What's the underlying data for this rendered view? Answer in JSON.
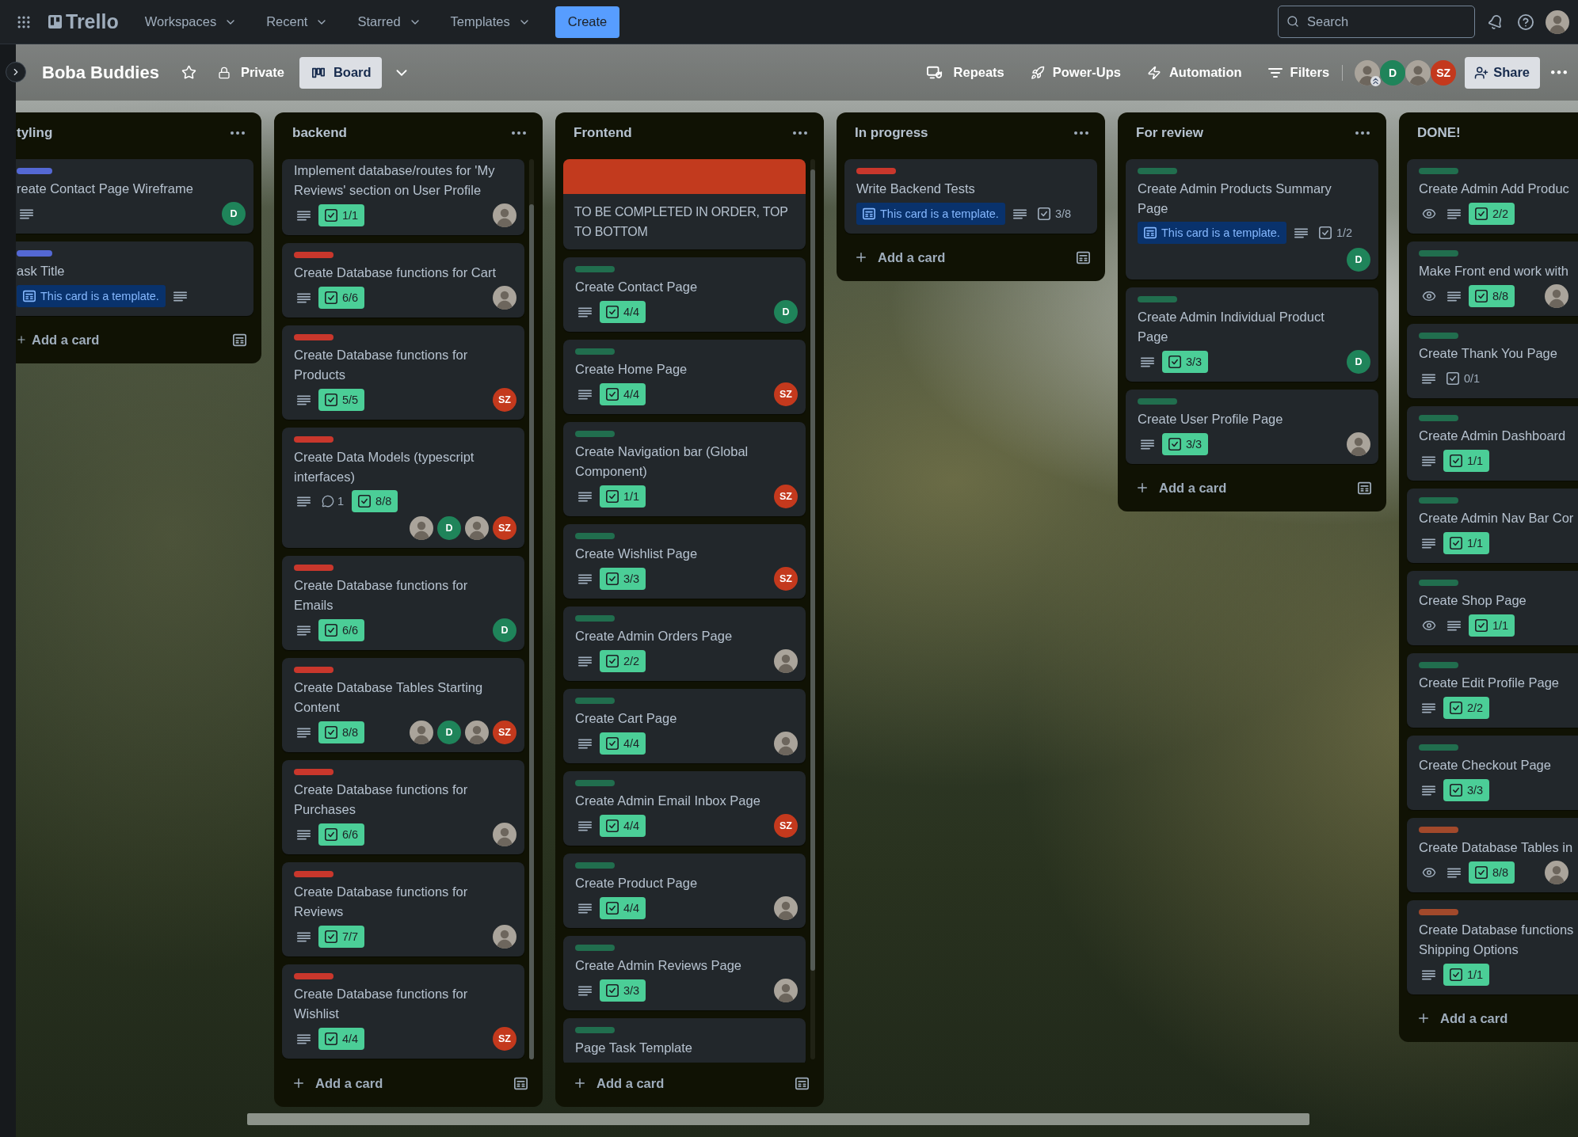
{
  "top_nav": {
    "logo": "Trello",
    "menus": [
      {
        "label": "Workspaces"
      },
      {
        "label": "Recent"
      },
      {
        "label": "Starred"
      },
      {
        "label": "Templates"
      }
    ],
    "create_button": "Create",
    "search": {
      "placeholder": "Search"
    }
  },
  "board_header": {
    "title": "Boba Buddies",
    "starred": false,
    "visibility": "Private",
    "view_button": "Board",
    "actions": [
      {
        "kind": "repeats",
        "label": "Repeats"
      },
      {
        "kind": "power_ups",
        "label": "Power-Ups"
      },
      {
        "kind": "automation",
        "label": "Automation"
      },
      {
        "kind": "filters",
        "label": "Filters"
      }
    ],
    "members": [
      {
        "kind": "photo",
        "admin": true
      },
      {
        "kind": "initials",
        "text": "D",
        "color": "#1f845a",
        "admin": false
      },
      {
        "kind": "photo",
        "admin": false
      },
      {
        "kind": "initials",
        "text": "SZ",
        "color": "#c4391d",
        "admin": false
      }
    ],
    "share_button": "Share"
  },
  "lists": [
    {
      "title": "tyling",
      "add_card": "Add a card",
      "cards": [
        {
          "label": {
            "color": "#5468d4"
          },
          "title": "reate Contact Page Wireframe",
          "watching": false,
          "description": true,
          "members": [
            {
              "kind": "initials",
              "text": "D",
              "color": "#1f845a"
            }
          ]
        },
        {
          "label": {
            "color": "#5468d4"
          },
          "title": "ask Title",
          "template_badge": "This card is a template.",
          "watching": false,
          "description": true
        }
      ]
    },
    {
      "title": "backend",
      "add_card": "Add a card",
      "cards": [
        {
          "title": "Implement database/routes for 'My Reviews' section on User Profile",
          "watching": false,
          "description": true,
          "checklist": {
            "text": "1/1",
            "complete": true
          },
          "members": [
            {
              "kind": "photo"
            }
          ]
        },
        {
          "label": {
            "color": "#c9372c"
          },
          "title": "Create Database functions for Cart",
          "watching": false,
          "description": true,
          "checklist": {
            "text": "6/6",
            "complete": true
          },
          "members": [
            {
              "kind": "photo"
            }
          ]
        },
        {
          "label": {
            "color": "#c9372c"
          },
          "title": "Create Database functions for Products",
          "watching": false,
          "description": true,
          "checklist": {
            "text": "5/5",
            "complete": true
          },
          "members": [
            {
              "kind": "initials",
              "text": "SZ",
              "color": "#c4391d"
            }
          ]
        },
        {
          "label": {
            "color": "#c9372c"
          },
          "title": "Create Data Models (typescript interfaces)",
          "watching": false,
          "description": true,
          "comments": "1",
          "checklist": {
            "text": "8/8",
            "complete": true
          },
          "members": [
            {
              "kind": "photo"
            },
            {
              "kind": "initials",
              "text": "D",
              "color": "#1f845a"
            },
            {
              "kind": "photo"
            },
            {
              "kind": "initials",
              "text": "SZ",
              "color": "#c4391d"
            }
          ]
        },
        {
          "label": {
            "color": "#c9372c"
          },
          "title": "Create Database functions for Emails",
          "watching": false,
          "description": true,
          "checklist": {
            "text": "6/6",
            "complete": true
          },
          "members": [
            {
              "kind": "initials",
              "text": "D",
              "color": "#1f845a"
            }
          ]
        },
        {
          "label": {
            "color": "#c9372c"
          },
          "title": "Create Database Tables Starting Content",
          "watching": false,
          "description": true,
          "checklist": {
            "text": "8/8",
            "complete": true
          },
          "members": [
            {
              "kind": "photo"
            },
            {
              "kind": "initials",
              "text": "D",
              "color": "#1f845a"
            },
            {
              "kind": "photo"
            },
            {
              "kind": "initials",
              "text": "SZ",
              "color": "#c4391d"
            }
          ]
        },
        {
          "label": {
            "color": "#c9372c"
          },
          "title": "Create Database functions for Purchases",
          "watching": false,
          "description": true,
          "checklist": {
            "text": "6/6",
            "complete": true
          },
          "members": [
            {
              "kind": "photo"
            }
          ]
        },
        {
          "label": {
            "color": "#c9372c"
          },
          "title": "Create Database functions for Reviews",
          "watching": false,
          "description": true,
          "checklist": {
            "text": "7/7",
            "complete": true
          },
          "members": [
            {
              "kind": "photo"
            }
          ]
        },
        {
          "label": {
            "color": "#c9372c"
          },
          "title": "Create Database functions for Wishlist",
          "watching": false,
          "description": true,
          "checklist": {
            "text": "4/4",
            "complete": true
          },
          "members": [
            {
              "kind": "initials",
              "text": "SZ",
              "color": "#c4391d"
            }
          ]
        }
      ]
    },
    {
      "title": "Frontend",
      "add_card": "Add a card",
      "cards": [
        {
          "cover": {
            "color": "#c23a1e"
          },
          "title": "TO BE COMPLETED IN ORDER, TOP TO BOTTOM",
          "watching": false,
          "description": false
        },
        {
          "label": {
            "color": "#216e4e"
          },
          "title": "Create Contact Page",
          "watching": false,
          "description": true,
          "checklist": {
            "text": "4/4",
            "complete": true
          },
          "members": [
            {
              "kind": "initials",
              "text": "D",
              "color": "#1f845a"
            }
          ]
        },
        {
          "label": {
            "color": "#216e4e"
          },
          "title": "Create Home Page",
          "watching": false,
          "description": true,
          "checklist": {
            "text": "4/4",
            "complete": true
          },
          "members": [
            {
              "kind": "initials",
              "text": "SZ",
              "color": "#c4391d"
            }
          ]
        },
        {
          "label": {
            "color": "#216e4e"
          },
          "title": "Create Navigation bar (Global Component)",
          "watching": false,
          "description": true,
          "checklist": {
            "text": "1/1",
            "complete": true
          },
          "members": [
            {
              "kind": "initials",
              "text": "SZ",
              "color": "#c4391d"
            }
          ]
        },
        {
          "label": {
            "color": "#216e4e"
          },
          "title": "Create Wishlist Page",
          "watching": false,
          "description": true,
          "checklist": {
            "text": "3/3",
            "complete": true
          },
          "members": [
            {
              "kind": "initials",
              "text": "SZ",
              "color": "#c4391d"
            }
          ]
        },
        {
          "label": {
            "color": "#216e4e"
          },
          "title": "Create Admin Orders Page",
          "watching": false,
          "description": true,
          "checklist": {
            "text": "2/2",
            "complete": true
          },
          "members": [
            {
              "kind": "photo"
            }
          ]
        },
        {
          "label": {
            "color": "#216e4e"
          },
          "title": "Create Cart Page",
          "watching": false,
          "description": true,
          "checklist": {
            "text": "4/4",
            "complete": true
          },
          "members": [
            {
              "kind": "photo"
            }
          ]
        },
        {
          "label": {
            "color": "#216e4e"
          },
          "title": "Create Admin Email Inbox Page",
          "watching": false,
          "description": true,
          "checklist": {
            "text": "4/4",
            "complete": true
          },
          "members": [
            {
              "kind": "initials",
              "text": "SZ",
              "color": "#c4391d"
            }
          ]
        },
        {
          "label": {
            "color": "#216e4e"
          },
          "title": "Create Product Page",
          "watching": false,
          "description": true,
          "checklist": {
            "text": "4/4",
            "complete": true
          },
          "members": [
            {
              "kind": "photo"
            }
          ]
        },
        {
          "label": {
            "color": "#216e4e"
          },
          "title": "Create Admin Reviews Page",
          "watching": false,
          "description": true,
          "checklist": {
            "text": "3/3",
            "complete": true
          },
          "members": [
            {
              "kind": "photo"
            }
          ]
        },
        {
          "label": {
            "color": "#216e4e"
          },
          "title": "Page Task Template",
          "watching": false,
          "description": false
        }
      ]
    },
    {
      "title": "In progress",
      "add_card": "Add a card",
      "cards": [
        {
          "label": {
            "color": "#c9372c"
          },
          "title": "Write Backend Tests",
          "template_badge": "This card is a template.",
          "watching": false,
          "description": true,
          "checklist": {
            "text": "3/8",
            "complete": false
          }
        }
      ]
    },
    {
      "title": "For review",
      "add_card": "Add a card",
      "cards": [
        {
          "label": {
            "color": "#216e4e"
          },
          "title": "Create Admin Products Summary Page",
          "template_badge": "This card is a template.",
          "watching": false,
          "description": true,
          "checklist": {
            "text": "1/2",
            "complete": false
          },
          "members": [
            {
              "kind": "initials",
              "text": "D",
              "color": "#1f845a"
            }
          ]
        },
        {
          "label": {
            "color": "#216e4e"
          },
          "title": "Create Admin Individual Product Page",
          "watching": false,
          "description": true,
          "checklist": {
            "text": "3/3",
            "complete": true
          },
          "members": [
            {
              "kind": "initials",
              "text": "D",
              "color": "#1f845a"
            }
          ]
        },
        {
          "label": {
            "color": "#216e4e"
          },
          "title": "Create User Profile Page",
          "watching": false,
          "description": true,
          "checklist": {
            "text": "3/3",
            "complete": true
          },
          "members": [
            {
              "kind": "photo"
            }
          ]
        }
      ]
    },
    {
      "title": "DONE!",
      "add_card": "Add a card",
      "cards": [
        {
          "label": {
            "color": "#216e4e"
          },
          "title": "Create Admin Add Produc",
          "watching": true,
          "description": true,
          "checklist": {
            "text": "2/2",
            "complete": true
          }
        },
        {
          "label": {
            "color": "#216e4e"
          },
          "title": "Make Front end work with",
          "watching": true,
          "description": true,
          "checklist": {
            "text": "8/8",
            "complete": true
          },
          "members": [
            {
              "kind": "photo"
            }
          ]
        },
        {
          "label": {
            "color": "#216e4e"
          },
          "title": "Create Thank You Page",
          "watching": false,
          "description": true,
          "checklist": {
            "text": "0/1",
            "complete": false
          }
        },
        {
          "label": {
            "color": "#216e4e"
          },
          "title": "Create Admin Dashboard",
          "watching": false,
          "description": true,
          "checklist": {
            "text": "1/1",
            "complete": true
          }
        },
        {
          "label": {
            "color": "#216e4e"
          },
          "title": "Create Admin Nav Bar Cor",
          "watching": false,
          "description": true,
          "checklist": {
            "text": "1/1",
            "complete": true
          }
        },
        {
          "label": {
            "color": "#216e4e"
          },
          "title": "Create Shop Page",
          "watching": true,
          "description": true,
          "checklist": {
            "text": "1/1",
            "complete": true
          }
        },
        {
          "label": {
            "color": "#216e4e"
          },
          "title": "Create Edit Profile Page",
          "watching": false,
          "description": true,
          "checklist": {
            "text": "2/2",
            "complete": true
          }
        },
        {
          "label": {
            "color": "#216e4e"
          },
          "title": "Create Checkout Page",
          "watching": false,
          "description": true,
          "checklist": {
            "text": "3/3",
            "complete": true
          }
        },
        {
          "label": {
            "color": "#a2492b"
          },
          "title": "Create Database Tables in",
          "watching": true,
          "description": true,
          "checklist": {
            "text": "8/8",
            "complete": true
          },
          "members": [
            {
              "kind": "photo"
            }
          ]
        },
        {
          "label": {
            "color": "#a2492b"
          },
          "title": "Create Database functions Shipping Options",
          "watching": false,
          "description": true,
          "checklist": {
            "text": "1/1",
            "complete": true
          }
        }
      ]
    }
  ]
}
